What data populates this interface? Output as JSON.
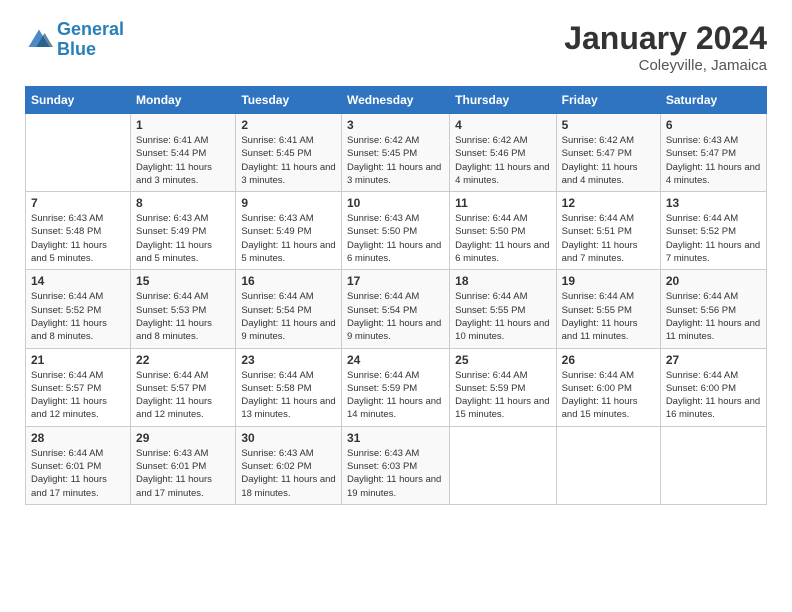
{
  "logo": {
    "line1": "General",
    "line2": "Blue"
  },
  "title": "January 2024",
  "subtitle": "Coleyville, Jamaica",
  "days_of_week": [
    "Sunday",
    "Monday",
    "Tuesday",
    "Wednesday",
    "Thursday",
    "Friday",
    "Saturday"
  ],
  "weeks": [
    [
      {
        "day": "",
        "sunrise": "",
        "sunset": "",
        "daylight": ""
      },
      {
        "day": "1",
        "sunrise": "Sunrise: 6:41 AM",
        "sunset": "Sunset: 5:44 PM",
        "daylight": "Daylight: 11 hours and 3 minutes."
      },
      {
        "day": "2",
        "sunrise": "Sunrise: 6:41 AM",
        "sunset": "Sunset: 5:45 PM",
        "daylight": "Daylight: 11 hours and 3 minutes."
      },
      {
        "day": "3",
        "sunrise": "Sunrise: 6:42 AM",
        "sunset": "Sunset: 5:45 PM",
        "daylight": "Daylight: 11 hours and 3 minutes."
      },
      {
        "day": "4",
        "sunrise": "Sunrise: 6:42 AM",
        "sunset": "Sunset: 5:46 PM",
        "daylight": "Daylight: 11 hours and 4 minutes."
      },
      {
        "day": "5",
        "sunrise": "Sunrise: 6:42 AM",
        "sunset": "Sunset: 5:47 PM",
        "daylight": "Daylight: 11 hours and 4 minutes."
      },
      {
        "day": "6",
        "sunrise": "Sunrise: 6:43 AM",
        "sunset": "Sunset: 5:47 PM",
        "daylight": "Daylight: 11 hours and 4 minutes."
      }
    ],
    [
      {
        "day": "7",
        "sunrise": "Sunrise: 6:43 AM",
        "sunset": "Sunset: 5:48 PM",
        "daylight": "Daylight: 11 hours and 5 minutes."
      },
      {
        "day": "8",
        "sunrise": "Sunrise: 6:43 AM",
        "sunset": "Sunset: 5:49 PM",
        "daylight": "Daylight: 11 hours and 5 minutes."
      },
      {
        "day": "9",
        "sunrise": "Sunrise: 6:43 AM",
        "sunset": "Sunset: 5:49 PM",
        "daylight": "Daylight: 11 hours and 5 minutes."
      },
      {
        "day": "10",
        "sunrise": "Sunrise: 6:43 AM",
        "sunset": "Sunset: 5:50 PM",
        "daylight": "Daylight: 11 hours and 6 minutes."
      },
      {
        "day": "11",
        "sunrise": "Sunrise: 6:44 AM",
        "sunset": "Sunset: 5:50 PM",
        "daylight": "Daylight: 11 hours and 6 minutes."
      },
      {
        "day": "12",
        "sunrise": "Sunrise: 6:44 AM",
        "sunset": "Sunset: 5:51 PM",
        "daylight": "Daylight: 11 hours and 7 minutes."
      },
      {
        "day": "13",
        "sunrise": "Sunrise: 6:44 AM",
        "sunset": "Sunset: 5:52 PM",
        "daylight": "Daylight: 11 hours and 7 minutes."
      }
    ],
    [
      {
        "day": "14",
        "sunrise": "Sunrise: 6:44 AM",
        "sunset": "Sunset: 5:52 PM",
        "daylight": "Daylight: 11 hours and 8 minutes."
      },
      {
        "day": "15",
        "sunrise": "Sunrise: 6:44 AM",
        "sunset": "Sunset: 5:53 PM",
        "daylight": "Daylight: 11 hours and 8 minutes."
      },
      {
        "day": "16",
        "sunrise": "Sunrise: 6:44 AM",
        "sunset": "Sunset: 5:54 PM",
        "daylight": "Daylight: 11 hours and 9 minutes."
      },
      {
        "day": "17",
        "sunrise": "Sunrise: 6:44 AM",
        "sunset": "Sunset: 5:54 PM",
        "daylight": "Daylight: 11 hours and 9 minutes."
      },
      {
        "day": "18",
        "sunrise": "Sunrise: 6:44 AM",
        "sunset": "Sunset: 5:55 PM",
        "daylight": "Daylight: 11 hours and 10 minutes."
      },
      {
        "day": "19",
        "sunrise": "Sunrise: 6:44 AM",
        "sunset": "Sunset: 5:55 PM",
        "daylight": "Daylight: 11 hours and 11 minutes."
      },
      {
        "day": "20",
        "sunrise": "Sunrise: 6:44 AM",
        "sunset": "Sunset: 5:56 PM",
        "daylight": "Daylight: 11 hours and 11 minutes."
      }
    ],
    [
      {
        "day": "21",
        "sunrise": "Sunrise: 6:44 AM",
        "sunset": "Sunset: 5:57 PM",
        "daylight": "Daylight: 11 hours and 12 minutes."
      },
      {
        "day": "22",
        "sunrise": "Sunrise: 6:44 AM",
        "sunset": "Sunset: 5:57 PM",
        "daylight": "Daylight: 11 hours and 12 minutes."
      },
      {
        "day": "23",
        "sunrise": "Sunrise: 6:44 AM",
        "sunset": "Sunset: 5:58 PM",
        "daylight": "Daylight: 11 hours and 13 minutes."
      },
      {
        "day": "24",
        "sunrise": "Sunrise: 6:44 AM",
        "sunset": "Sunset: 5:59 PM",
        "daylight": "Daylight: 11 hours and 14 minutes."
      },
      {
        "day": "25",
        "sunrise": "Sunrise: 6:44 AM",
        "sunset": "Sunset: 5:59 PM",
        "daylight": "Daylight: 11 hours and 15 minutes."
      },
      {
        "day": "26",
        "sunrise": "Sunrise: 6:44 AM",
        "sunset": "Sunset: 6:00 PM",
        "daylight": "Daylight: 11 hours and 15 minutes."
      },
      {
        "day": "27",
        "sunrise": "Sunrise: 6:44 AM",
        "sunset": "Sunset: 6:00 PM",
        "daylight": "Daylight: 11 hours and 16 minutes."
      }
    ],
    [
      {
        "day": "28",
        "sunrise": "Sunrise: 6:44 AM",
        "sunset": "Sunset: 6:01 PM",
        "daylight": "Daylight: 11 hours and 17 minutes."
      },
      {
        "day": "29",
        "sunrise": "Sunrise: 6:43 AM",
        "sunset": "Sunset: 6:01 PM",
        "daylight": "Daylight: 11 hours and 17 minutes."
      },
      {
        "day": "30",
        "sunrise": "Sunrise: 6:43 AM",
        "sunset": "Sunset: 6:02 PM",
        "daylight": "Daylight: 11 hours and 18 minutes."
      },
      {
        "day": "31",
        "sunrise": "Sunrise: 6:43 AM",
        "sunset": "Sunset: 6:03 PM",
        "daylight": "Daylight: 11 hours and 19 minutes."
      },
      {
        "day": "",
        "sunrise": "",
        "sunset": "",
        "daylight": ""
      },
      {
        "day": "",
        "sunrise": "",
        "sunset": "",
        "daylight": ""
      },
      {
        "day": "",
        "sunrise": "",
        "sunset": "",
        "daylight": ""
      }
    ]
  ]
}
